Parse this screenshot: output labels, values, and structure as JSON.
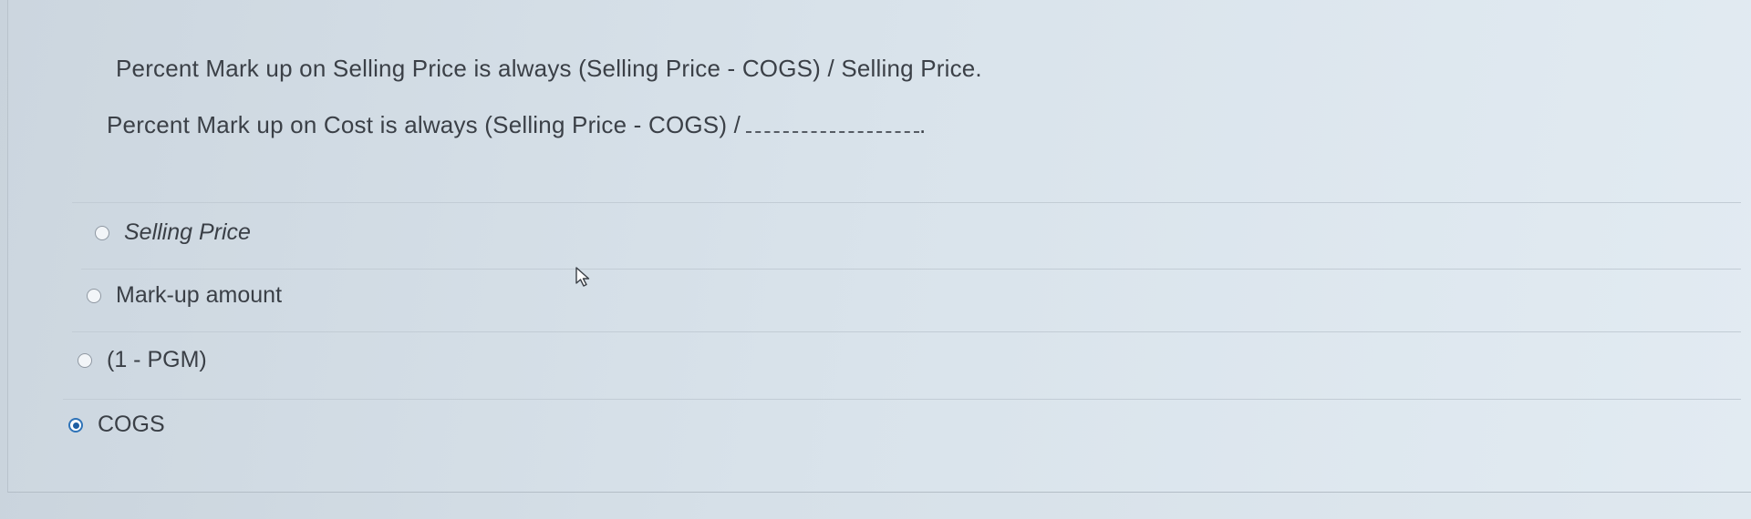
{
  "question": {
    "line1": "Percent Mark up on Selling Price is always (Selling Price - COGS) / Selling Price.",
    "line2": "Percent Mark up on Cost is always (Selling Price - COGS) /",
    "line2_end": "."
  },
  "options": [
    {
      "label": "Selling Price",
      "selected": false
    },
    {
      "label": "Mark-up amount",
      "selected": false
    },
    {
      "label": "(1 - PGM)",
      "selected": false
    },
    {
      "label": "COGS",
      "selected": true
    }
  ],
  "colors": {
    "selected_radio": "#1f5fa3",
    "text": "#3a3f46"
  },
  "icons": {
    "cursor": "mouse-pointer-icon"
  }
}
